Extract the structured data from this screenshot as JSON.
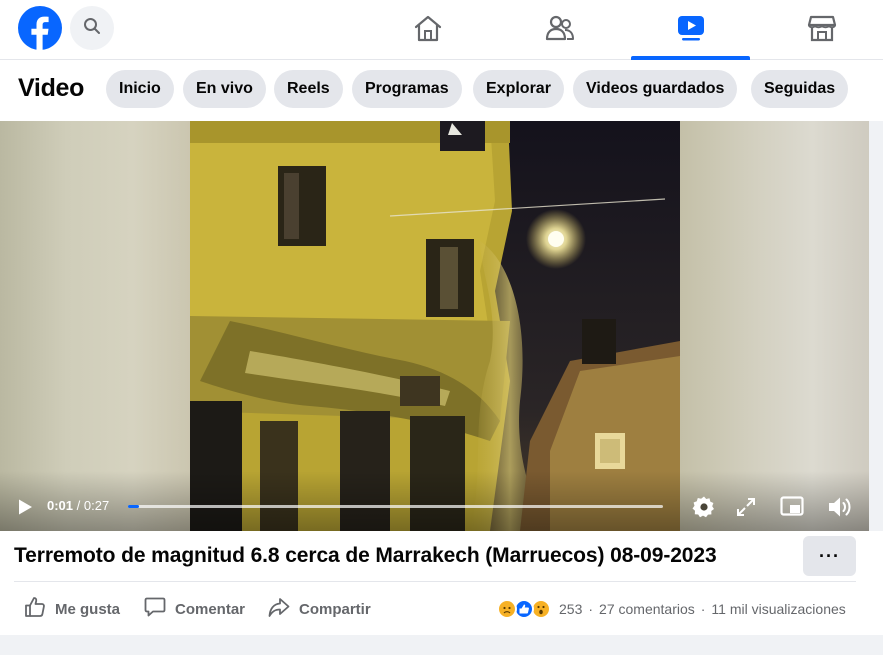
{
  "header": {
    "logo": "facebook-logo",
    "search_icon": "search-icon",
    "nav_tabs": [
      {
        "name": "home-icon",
        "active": false
      },
      {
        "name": "friends-icon",
        "active": false
      },
      {
        "name": "video-icon",
        "active": true
      },
      {
        "name": "marketplace-icon",
        "active": false
      }
    ],
    "accent_color": "#0866ff"
  },
  "subbar": {
    "title": "Video",
    "chips": [
      "Inicio",
      "En vivo",
      "Reels",
      "Programas",
      "Explorar",
      "Videos guardados",
      "Seguidas"
    ]
  },
  "player": {
    "current_time": "0:01",
    "separator": " / ",
    "duration": "0:27",
    "progress_fraction": 0.02,
    "controls": [
      "play-icon",
      "settings-icon",
      "fullscreen-icon",
      "picture-in-picture-icon",
      "volume-icon"
    ]
  },
  "post": {
    "title": "Terremoto de magnitud 6.8 cerca de Marrakech (Marruecos) 08-09-2023",
    "more_label": "···",
    "actions": {
      "like": "Me gusta",
      "comment": "Comentar",
      "share": "Compartir"
    },
    "reactions": [
      "sad-reaction-icon",
      "like-reaction-icon",
      "wow-reaction-icon"
    ],
    "reaction_count": "253",
    "comments": "27 comentarios",
    "views": "11 mil visualizaciones",
    "stat_separator": "·"
  }
}
